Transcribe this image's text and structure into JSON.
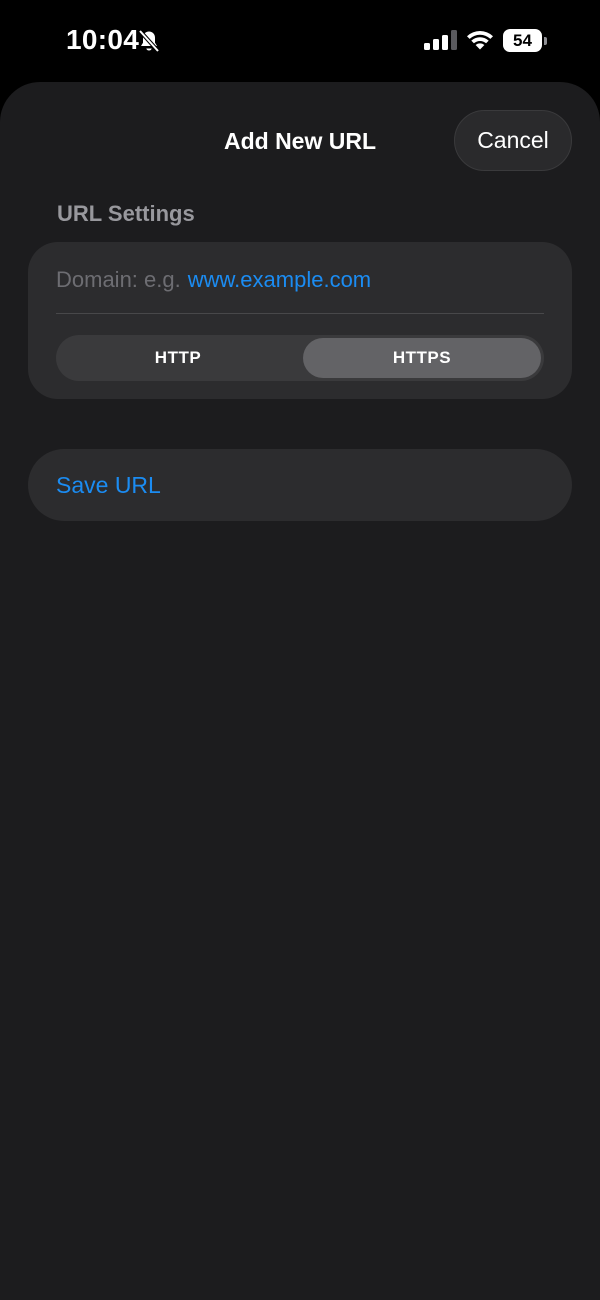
{
  "status_bar": {
    "time": "10:04",
    "battery_level": "54",
    "icons": [
      "bell-slash-icon",
      "cellular-signal-icon",
      "wifi-icon",
      "battery-icon"
    ]
  },
  "sheet": {
    "title": "Add New URL",
    "cancel_label": "Cancel"
  },
  "url_settings": {
    "header": "URL Settings",
    "domain_placeholder_prefix": "Domain: e.g.",
    "domain_placeholder_example": "www.example.com",
    "protocol": {
      "options": [
        "HTTP",
        "HTTPS"
      ],
      "selected": "HTTPS"
    }
  },
  "actions": {
    "save_label": "Save URL"
  },
  "colors": {
    "background": "#000000",
    "sheet": "#1c1c1e",
    "card": "#2c2c2e",
    "accent": "#1b8cf2",
    "segment_selected": "#636366"
  }
}
